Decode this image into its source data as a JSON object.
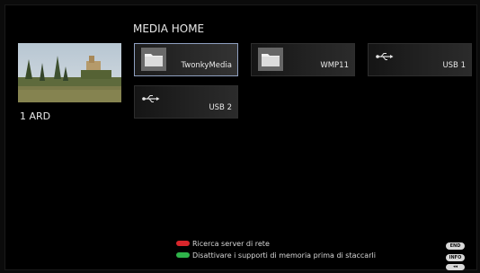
{
  "header": {
    "title": "MEDIA HOME"
  },
  "channel": {
    "label": "1  ARD"
  },
  "sources": [
    {
      "label": "TwonkyMedia",
      "icon": "folder-icon"
    },
    {
      "label": "WMP11",
      "icon": "folder-icon"
    },
    {
      "label": "USB 1",
      "icon": "usb-icon"
    },
    {
      "label": "USB 2",
      "icon": "usb-icon"
    }
  ],
  "footer": {
    "hint_red": "Ricerca server di rete",
    "hint_green": "Disattivare i supporti di memoria prima di staccarli",
    "key_end": "END",
    "key_info": "INFO",
    "key_back": "◂◂"
  },
  "colors": {
    "red": "#d8262b",
    "green": "#2fb34a",
    "selected_border": "#8fa0c0"
  }
}
